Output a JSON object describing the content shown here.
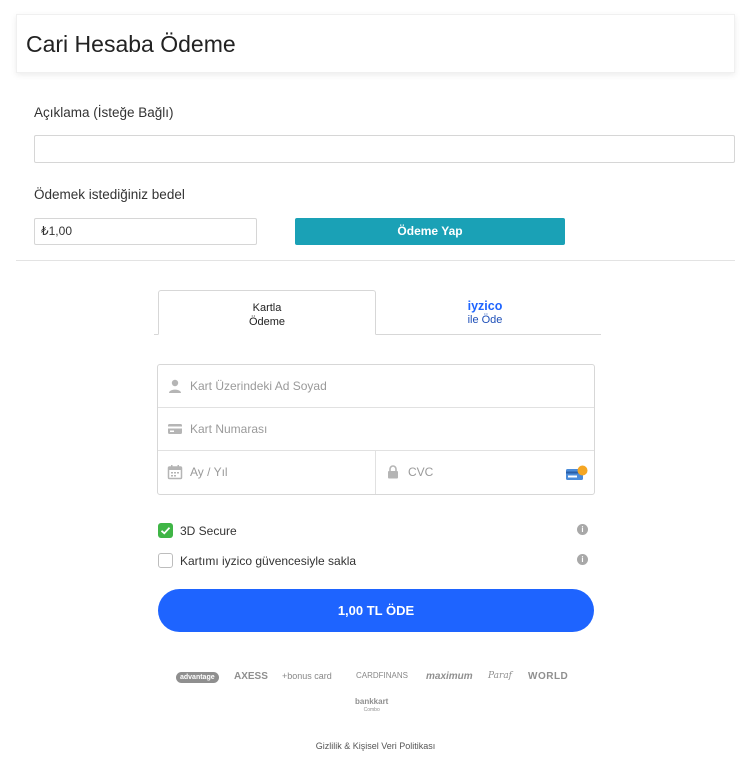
{
  "page": {
    "title": "Cari Hesaba Ödeme"
  },
  "form": {
    "description_label": "Açıklama (İsteğe Bağlı)",
    "description_value": "",
    "amount_label": "Ödemek istediğiniz bedel",
    "amount_value": "₺1,00",
    "pay_button_label": "Ödeme Yap"
  },
  "tabs": {
    "card_tab_line1": "Kartla",
    "card_tab_line2": "Ödeme",
    "iyzico_tab_brand": "iyzico",
    "iyzico_tab_sub": "ile Öde"
  },
  "card_form": {
    "name_placeholder": "Kart Üzerindeki Ad Soyad",
    "number_placeholder": "Kart Numarası",
    "expiry_placeholder": "Ay / Yıl",
    "cvc_placeholder": "CVC"
  },
  "options": {
    "secure_label": "3D Secure",
    "secure_checked": true,
    "save_card_label": "Kartımı iyzico güvencesiyle sakla",
    "save_card_checked": false
  },
  "submit": {
    "label": "1,00 TL ÖDE"
  },
  "logos": {
    "advantage": "advantage",
    "axess": "AXESS",
    "bonus": "+bonus card",
    "cardfinans": "CARDFINANS",
    "maximum": "maximum",
    "paraf": "Paraf",
    "world": "WORLD",
    "bankkart": "bankkart",
    "bankkart_sub": "Combo"
  },
  "footer": {
    "privacy_link": "Gizlilik & Kişisel Veri Politikası"
  },
  "colors": {
    "pay_button": "#1aa1b6",
    "submit_button": "#1e64ff",
    "iyzico_blue": "#1e64ff",
    "checkbox_checked": "#3fb546"
  }
}
